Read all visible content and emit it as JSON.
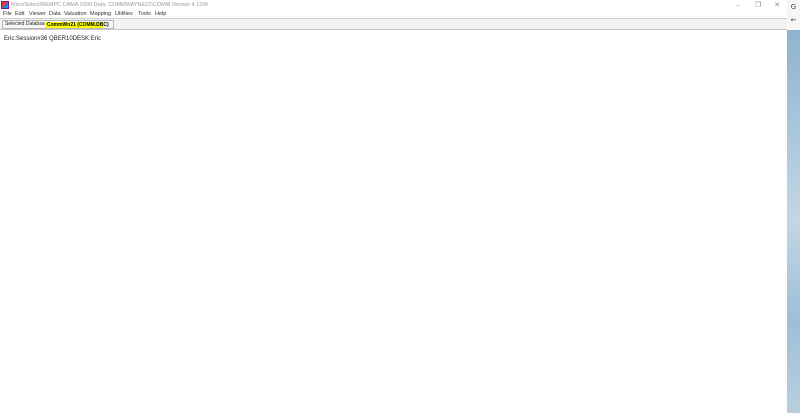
{
  "window": {
    "title": "MicroSelect/REMPC CAMA 2000  Data: COMMWAYNE21\\COMM Version 4.120h",
    "controls": {
      "minimize": "–",
      "maximize": "❐",
      "close": "✕"
    }
  },
  "menu": {
    "items": [
      "File",
      "Edit",
      "Viewer",
      "Data",
      "Valuation",
      "Mapping",
      "Utilities",
      "Tools",
      "Help"
    ]
  },
  "toolbar": {
    "selected_database_label": "Selected Database",
    "selected_database_value": "CommWn21  (COMM.DBC)",
    "highlight_color": "#ffff00"
  },
  "main": {
    "session_text": "Eric:Session#36 QBER10DESK:Eric"
  },
  "side": {
    "top_glyph": "G",
    "back_glyph": "←"
  }
}
